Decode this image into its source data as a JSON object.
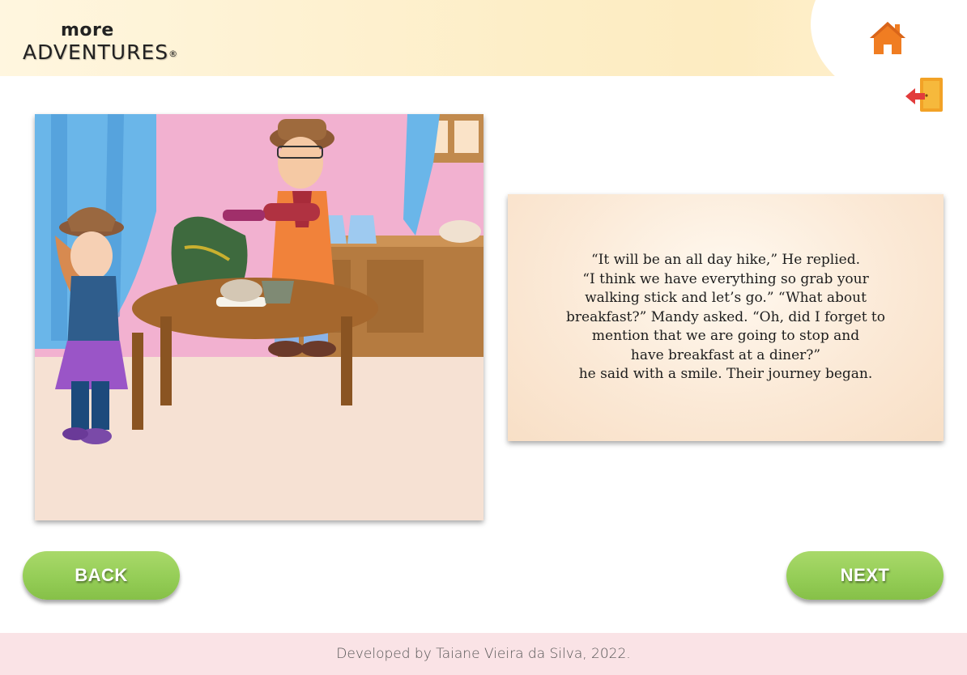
{
  "header": {
    "logo_top": "more",
    "logo_bottom": "ADVENTURES",
    "logo_reg": "®",
    "home_icon": "home-icon",
    "exit_icon": "exit-door-icon"
  },
  "story": {
    "lines": [
      "“It will be an all day hike,” He replied.",
      "“I think we have everything so grab your",
      "walking stick and let’s go.” “What about",
      "breakfast?” Mandy asked. “Oh, did I forget to",
      "mention that we are going to stop and",
      "have breakfast at a diner?”",
      "he said with a smile. Their journey began."
    ]
  },
  "nav": {
    "back_label": "BACK",
    "next_label": "NEXT"
  },
  "footer": {
    "credit": "Developed by Taiane Vieira da Silva, 2022."
  },
  "colors": {
    "accent_green": "#93cc55",
    "home_orange": "#f07d22",
    "exit_red": "#e23b3b",
    "footer_bg": "#fae3e6"
  }
}
